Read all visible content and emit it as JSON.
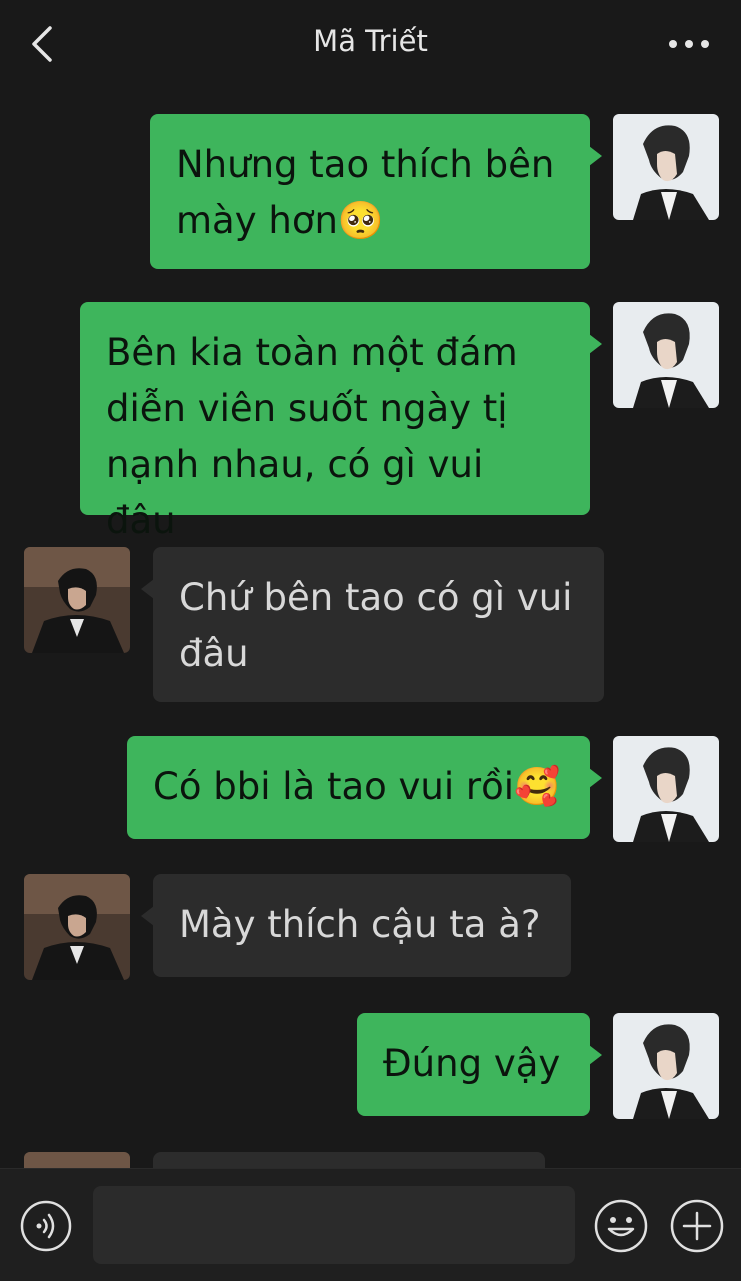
{
  "header": {
    "title": "Mã Triết"
  },
  "messages": [
    {
      "sender": "me",
      "text": "Nhưng tao thích bên mày hơn🥺"
    },
    {
      "sender": "me",
      "text": "Bên kia toàn một đám diễn viên suốt ngày tị nạnh nhau, có gì vui đâu"
    },
    {
      "sender": "them",
      "text": "Chứ bên tao có gì vui đâu"
    },
    {
      "sender": "me",
      "text": "Có bbi là tao vui rồi🥰"
    },
    {
      "sender": "them",
      "text": "Mày thích cậu ta à?"
    },
    {
      "sender": "me",
      "text": "Đúng vậy"
    },
    {
      "sender": "them",
      "text": ""
    }
  ],
  "input": {
    "value": "",
    "placeholder": ""
  },
  "icons": {
    "back": "chevron-left-icon",
    "more": "more-dots-icon",
    "voice": "voice-icon",
    "emoji": "emoji-icon",
    "plus": "plus-icon"
  },
  "colors": {
    "background": "#191919",
    "my_bubble": "#3eb55c",
    "their_bubble": "#2c2c2c"
  }
}
